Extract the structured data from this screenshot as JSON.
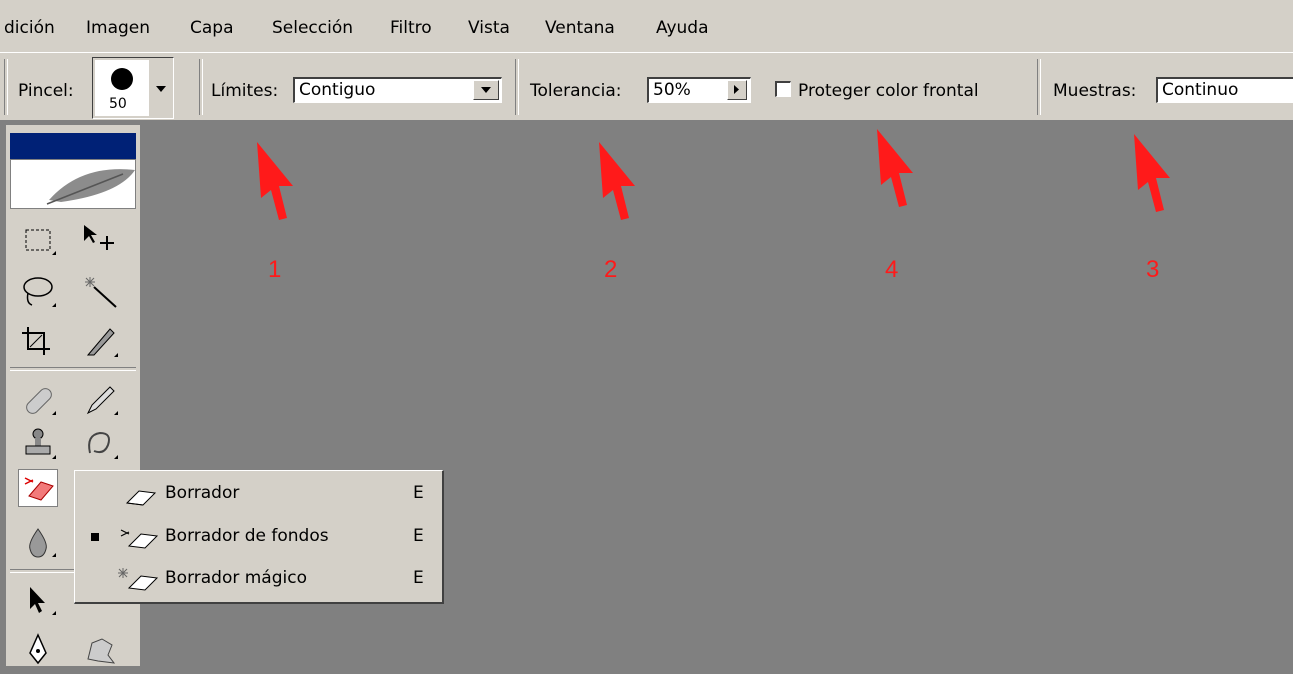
{
  "menubar": {
    "items": [
      "dición",
      "Imagen",
      "Capa",
      "Selección",
      "Filtro",
      "Vista",
      "Ventana",
      "Ayuda"
    ]
  },
  "options": {
    "brush_label": "Pincel:",
    "brush_size": "50",
    "limits_label": "Límites:",
    "limits_value": "Contiguo",
    "tolerance_label": "Tolerancia:",
    "tolerance_value": "50%",
    "protect_label": "Proteger color frontal",
    "protect_checked": false,
    "samples_label": "Muestras:",
    "samples_value": "Continuo"
  },
  "flyout": {
    "items": [
      {
        "name": "Borrador",
        "key": "E",
        "icon": "eraser-icon",
        "selected": false
      },
      {
        "name": "Borrador de fondos",
        "key": "E",
        "icon": "background-eraser-icon",
        "selected": true
      },
      {
        "name": "Borrador mágico",
        "key": "E",
        "icon": "magic-eraser-icon",
        "selected": false
      }
    ]
  },
  "annotations": {
    "numbers": [
      "1",
      "2",
      "4",
      "3"
    ],
    "color": "#ff1a1a"
  },
  "colors": {
    "chrome": "#d4d0c8",
    "canvas": "#808080",
    "title_bar": "#002176"
  }
}
